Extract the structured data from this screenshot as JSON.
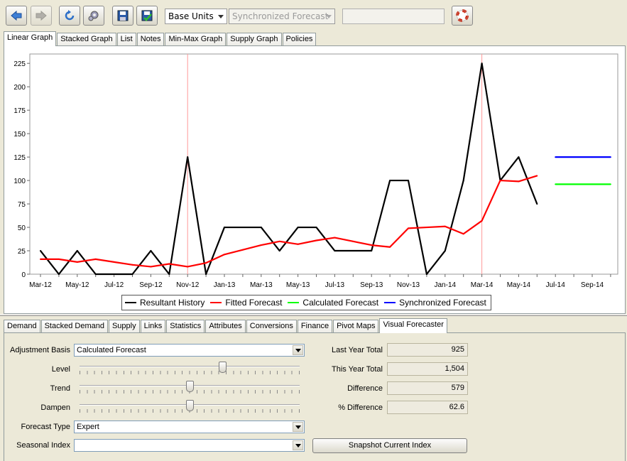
{
  "toolbar": {
    "buttons": [
      {
        "icon": "back-arrow-icon"
      },
      {
        "icon": "forward-arrow-icon"
      },
      {
        "icon": "refresh-icon"
      },
      {
        "icon": "settings-icon"
      },
      {
        "icon": "save-icon"
      },
      {
        "icon": "save-check-icon"
      },
      {
        "icon": "help-lifebuoy-icon"
      }
    ],
    "units_combo": "Base Units",
    "forecast_combo": "Synchronized Forecast",
    "blank_field": ""
  },
  "top_tabs": [
    "Linear Graph",
    "Stacked Graph",
    "List",
    "Notes",
    "Min-Max Graph",
    "Supply Graph",
    "Policies"
  ],
  "top_active_tab": 0,
  "legend": {
    "items": [
      {
        "label": "Resultant History",
        "color": "#000000"
      },
      {
        "label": "Fitted Forecast",
        "color": "#ff0000"
      },
      {
        "label": "Calculated Forecast",
        "color": "#00ff00"
      },
      {
        "label": "Synchronized Forecast",
        "color": "#0000ff"
      }
    ]
  },
  "chart_data": {
    "type": "line",
    "x": [
      "Mar-12",
      "Apr-12",
      "May-12",
      "Jun-12",
      "Jul-12",
      "Aug-12",
      "Sep-12",
      "Oct-12",
      "Nov-12",
      "Dec-12",
      "Jan-13",
      "Feb-13",
      "Mar-13",
      "Apr-13",
      "May-13",
      "Jun-13",
      "Jul-13",
      "Aug-13",
      "Sep-13",
      "Oct-13",
      "Nov-13",
      "Dec-13",
      "Jan-14",
      "Feb-14",
      "Mar-14",
      "Apr-14",
      "May-14",
      "Jun-14",
      "Jul-14",
      "Aug-14",
      "Sep-14",
      "Oct-14"
    ],
    "tick_labels": [
      "Mar-12",
      "May-12",
      "Jul-12",
      "Sep-12",
      "Nov-12",
      "Jan-13",
      "Mar-13",
      "May-13",
      "Jul-13",
      "Sep-13",
      "Nov-13",
      "Jan-14",
      "Mar-14",
      "May-14",
      "Jul-14",
      "Sep-14"
    ],
    "series": [
      {
        "name": "Resultant History",
        "color": "#000000",
        "values": [
          25,
          0,
          25,
          0,
          0,
          0,
          25,
          0,
          125,
          0,
          50,
          50,
          50,
          25,
          50,
          50,
          25,
          25,
          25,
          100,
          100,
          0,
          25,
          100,
          225,
          100,
          125,
          75,
          null,
          null,
          null,
          null
        ]
      },
      {
        "name": "Fitted Forecast",
        "color": "#ff0000",
        "values": [
          16,
          16,
          13,
          16,
          13,
          10,
          8,
          11,
          8,
          12,
          21,
          26,
          31,
          35,
          32,
          36,
          39,
          35,
          31,
          29,
          49,
          50,
          51,
          43,
          57,
          100,
          99,
          105,
          null,
          null,
          null,
          null
        ]
      },
      {
        "name": "Calculated Forecast",
        "color": "#00ff00",
        "values": [
          null,
          null,
          null,
          null,
          null,
          null,
          null,
          null,
          null,
          null,
          null,
          null,
          null,
          null,
          null,
          null,
          null,
          null,
          null,
          null,
          null,
          null,
          null,
          null,
          null,
          null,
          null,
          null,
          96,
          96,
          96,
          96
        ]
      },
      {
        "name": "Synchronized Forecast",
        "color": "#0000ff",
        "values": [
          null,
          null,
          null,
          null,
          null,
          null,
          null,
          null,
          null,
          null,
          null,
          null,
          null,
          null,
          null,
          null,
          null,
          null,
          null,
          null,
          null,
          null,
          null,
          null,
          null,
          null,
          null,
          null,
          125,
          125,
          125,
          125
        ]
      }
    ],
    "y_ticks": [
      0,
      25,
      50,
      75,
      100,
      125,
      150,
      175,
      200,
      225
    ],
    "ylim": [
      0,
      235
    ],
    "markers_at": [
      "Nov-12",
      "Mar-14"
    ],
    "marker_color": "#ff9999",
    "grid": false,
    "legend_position": "bottom-center"
  },
  "bottom_tabs": [
    "Demand",
    "Stacked Demand",
    "Supply",
    "Links",
    "Statistics",
    "Attributes",
    "Conversions",
    "Finance",
    "Pivot Maps",
    "Visual Forecaster"
  ],
  "bottom_active_tab": 9,
  "form": {
    "adjustment_basis_label": "Adjustment Basis",
    "adjustment_basis_value": "Calculated Forecast",
    "level_label": "Level",
    "level_value": 0.65,
    "trend_label": "Trend",
    "trend_value": 0.5,
    "dampen_label": "Dampen",
    "dampen_value": 0.5,
    "forecast_type_label": "Forecast Type",
    "forecast_type_value": "Expert",
    "seasonal_index_label": "Seasonal Index",
    "seasonal_index_value": "",
    "last_year_total_label": "Last Year Total",
    "last_year_total": "925",
    "this_year_total_label": "This Year Total",
    "this_year_total": "1,504",
    "difference_label": "Difference",
    "difference": "579",
    "pct_difference_label": "% Difference",
    "pct_difference": "62.6",
    "snapshot_button": "Snapshot Current Index"
  }
}
